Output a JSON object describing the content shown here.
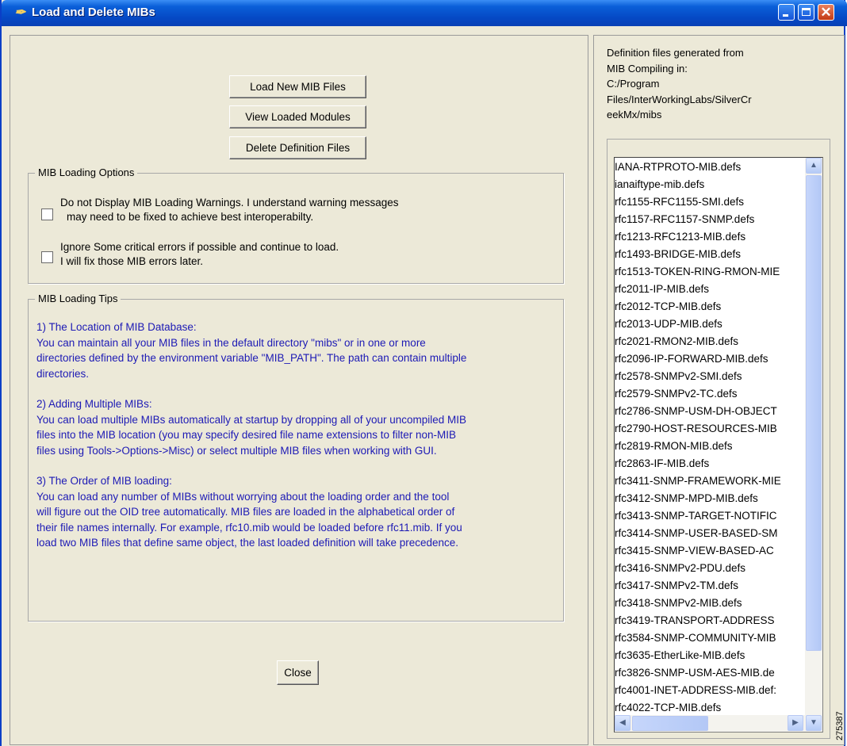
{
  "window": {
    "title": "Load and Delete MIBs"
  },
  "buttons": {
    "load": "Load New MIB Files",
    "view": "View Loaded Modules",
    "delete": "Delete Definition Files",
    "close": "Close"
  },
  "options": {
    "legend": "MIB Loading Options",
    "opt1_line1": "Do not Display MIB Loading Warnings. I understand warning messages",
    "opt1_line2": "may need to be fixed to achieve best interoperabilty.",
    "opt2_line1": "Ignore Some critical errors if possible and continue to load.",
    "opt2_line2": "I will fix those MIB errors later."
  },
  "tips": {
    "legend": "MIB Loading Tips",
    "tip1": "1) The Location of MIB Database:\n You can maintain all your MIB files in the default directory \"mibs\" or in one or more\ndirectories defined by the environment variable \"MIB_PATH\". The path can contain multiple\ndirectories.",
    "tip2": "2) Adding Multiple MIBs:\n You can load multiple MIBs automatically at startup by dropping all of your uncompiled MIB\nfiles into the MIB location (you may specify desired file name extensions to filter non-MIB\nfiles using Tools->Options->Misc) or select multiple MIB files  when working with GUI.",
    "tip3": "3) The Order of MIB loading:\n You can load any number of MIBs without worrying about the loading order and the tool\nwill figure out the OID tree automatically. MIB files are loaded in the alphabetical order of\ntheir file names internally. For example, rfc10.mib would be loaded before rfc11.mib.  If you\nload two MIB files that define same object, the last loaded definition will take precedence."
  },
  "definitions": {
    "line1": "Definition files generated from",
    "line2": "MIB Compiling in:",
    "line3": "C:/Program",
    "line4": "Files/InterWorkingLabs/SilverCr",
    "line5": "eekMx/mibs"
  },
  "files": [
    "IANA-RTPROTO-MIB.defs",
    "ianaiftype-mib.defs",
    "rfc1155-RFC1155-SMI.defs",
    "rfc1157-RFC1157-SNMP.defs",
    "rfc1213-RFC1213-MIB.defs",
    "rfc1493-BRIDGE-MIB.defs",
    "rfc1513-TOKEN-RING-RMON-MIE",
    "rfc2011-IP-MIB.defs",
    "rfc2012-TCP-MIB.defs",
    "rfc2013-UDP-MIB.defs",
    "rfc2021-RMON2-MIB.defs",
    "rfc2096-IP-FORWARD-MIB.defs",
    "rfc2578-SNMPv2-SMI.defs",
    "rfc2579-SNMPv2-TC.defs",
    "rfc2786-SNMP-USM-DH-OBJECT",
    "rfc2790-HOST-RESOURCES-MIB",
    "rfc2819-RMON-MIB.defs",
    "rfc2863-IF-MIB.defs",
    "rfc3411-SNMP-FRAMEWORK-MIE",
    "rfc3412-SNMP-MPD-MIB.defs",
    "rfc3413-SNMP-TARGET-NOTIFIC",
    "rfc3414-SNMP-USER-BASED-SM",
    "rfc3415-SNMP-VIEW-BASED-AC",
    "rfc3416-SNMPv2-PDU.defs",
    "rfc3417-SNMPv2-TM.defs",
    "rfc3418-SNMPv2-MIB.defs",
    "rfc3419-TRANSPORT-ADDRESS",
    "rfc3584-SNMP-COMMUNITY-MIB",
    "rfc3635-EtherLike-MIB.defs",
    "rfc3826-SNMP-USM-AES-MIB.de",
    "rfc4001-INET-ADDRESS-MIB.def:",
    "rfc4022-TCP-MIB.defs"
  ],
  "figure_id": "275387",
  "icons": {
    "app": "feather-icon",
    "minimize": "minimize-icon",
    "maximize": "maximize-icon",
    "close": "close-icon"
  }
}
